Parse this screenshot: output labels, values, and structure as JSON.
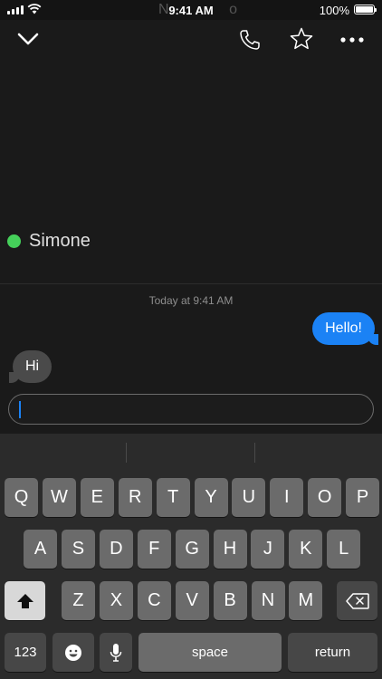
{
  "status_bar": {
    "time": "9:41 AM",
    "battery_pct": "100%",
    "faded_title": "N",
    "faded_title_tail": "o"
  },
  "header": {
    "contact_name": "Simone",
    "online_color": "#45d05a",
    "icons": [
      "chevron-down-icon",
      "phone-icon",
      "star-icon",
      "more-icon"
    ]
  },
  "thread": {
    "timestamp": "Today at 9:41 AM",
    "messages": [
      {
        "direction": "outgoing",
        "text": "Hello!",
        "color": "#1b82f5"
      },
      {
        "direction": "incoming",
        "text": "Hi",
        "color": "#4a4a4a"
      }
    ]
  },
  "composer": {
    "value": ""
  },
  "keyboard": {
    "row1": [
      "Q",
      "W",
      "E",
      "R",
      "T",
      "Y",
      "U",
      "I",
      "O",
      "P"
    ],
    "row2": [
      "A",
      "S",
      "D",
      "F",
      "G",
      "H",
      "J",
      "K",
      "L"
    ],
    "row3": [
      "Z",
      "X",
      "C",
      "V",
      "B",
      "N",
      "M"
    ],
    "numbers_label": "123",
    "space_label": "space",
    "return_label": "return"
  }
}
